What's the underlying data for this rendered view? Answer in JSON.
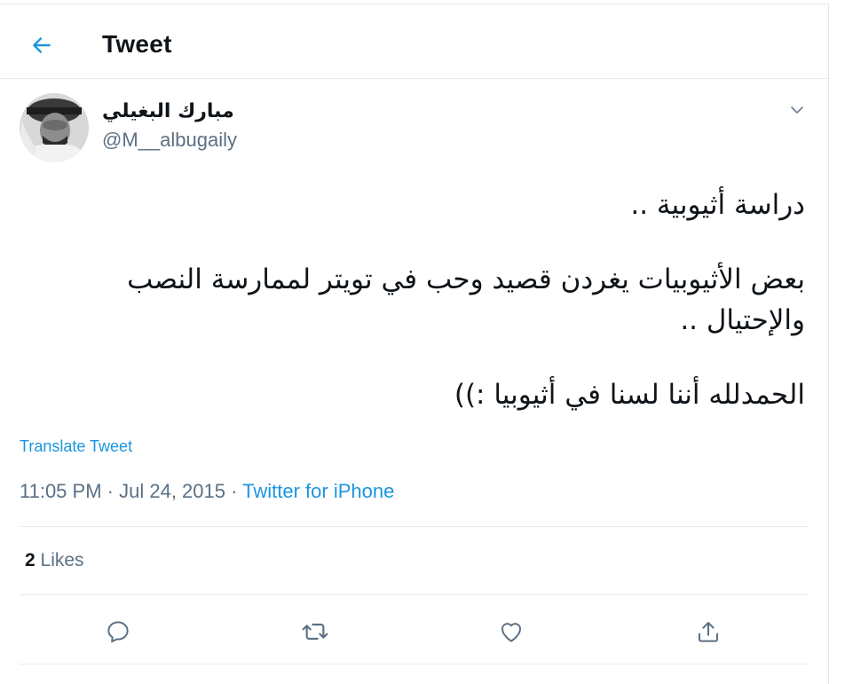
{
  "header": {
    "title": "Tweet",
    "back_icon": "arrow-left-icon"
  },
  "author": {
    "display_name": "مبارك البغيلي",
    "handle": "@M__albugaily",
    "avatar_icon": "user-avatar"
  },
  "tweet": {
    "line1": "دراسة أثيوبية ..",
    "line2": "بعض الأثيوبيات يغردن قصيد وحب في تويتر لممارسة النصب والإحتيال ..",
    "line3": "الحمدلله أننا لسنا في أثيوبيا :))"
  },
  "translate_label": "Translate Tweet",
  "meta": {
    "time": "11:05 PM",
    "date": "Jul 24, 2015",
    "separator": " · ",
    "source": "Twitter for iPhone"
  },
  "stats": {
    "likes_count": "2",
    "likes_label": "Likes"
  },
  "colors": {
    "accent": "#1b95e0",
    "muted": "#5b7083",
    "border": "#e6ecf0"
  },
  "icons": {
    "reply": "reply-icon",
    "retweet": "retweet-icon",
    "like": "heart-icon",
    "share": "share-icon",
    "more": "chevron-down-icon"
  }
}
